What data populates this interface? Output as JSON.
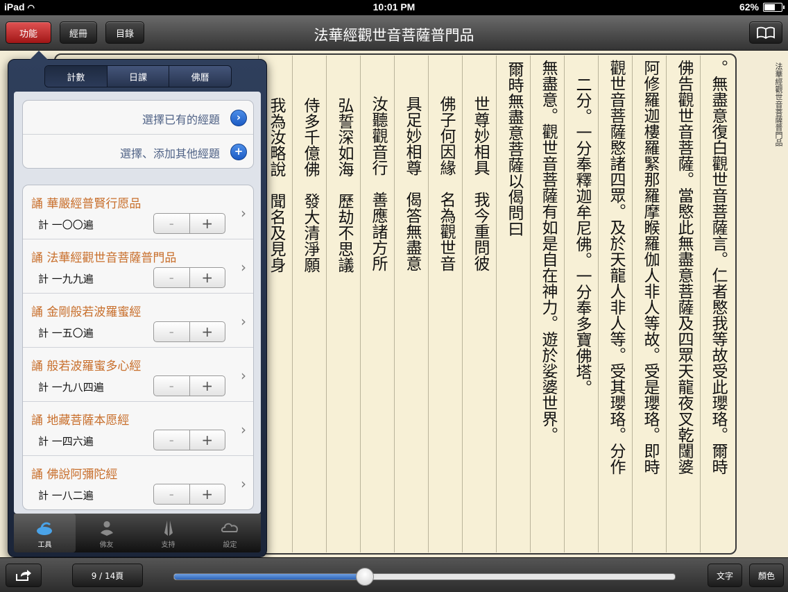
{
  "status_bar": {
    "device": "iPad",
    "time": "10:01 PM",
    "battery": "62%"
  },
  "nav": {
    "left_buttons": [
      "功能",
      "經冊",
      "目錄"
    ],
    "title": "法華經觀世音菩薩普門品"
  },
  "page": {
    "side_title": "法華經觀世音菩薩普門品",
    "columns": [
      "。無盡意復白觀世音菩薩言。仁者愍我等故受此瓔珞。爾時",
      "佛告觀世音菩薩。當愍此無盡意菩薩及四眾天龍夜叉乾闥婆",
      "阿修羅迦樓羅緊那羅摩睺羅伽人非人等故。受是瓔珞。即時",
      "觀世音菩薩愍諸四眾。及於天龍人非人等。受其瓔珞。分作",
      "二分。一分奉釋迦牟尼佛。一分奉多寶佛塔。",
      "無盡意。觀世音菩薩有如是自在神力。遊於娑婆世界。",
      "爾時無盡意菩薩以偈問曰",
      "世尊妙相具　我今重問彼",
      "佛子何因緣　名為觀世音",
      "具足妙相尊　偈答無盡意",
      "汝聽觀音行　善應諸方所",
      "弘誓深如海　歷劫不思議",
      "侍多千億佛　發大清淨願",
      "我為汝略說　聞名及見身"
    ]
  },
  "popover": {
    "segments": [
      "計數",
      "日課",
      "佛曆"
    ],
    "selected_segment": "計數",
    "actions": [
      {
        "label": "選擇已有的經題",
        "icon": "chevron-circle-icon"
      },
      {
        "label": "選擇、添加其他經題",
        "icon": "plus-circle-icon"
      }
    ],
    "counters": [
      {
        "title": "誦 華嚴經普賢行愿品",
        "count": "計 一〇〇遍"
      },
      {
        "title": "誦 法華經觀世音菩薩普門品",
        "count": "計 一九九遍"
      },
      {
        "title": "誦 金剛般若波羅蜜經",
        "count": "計 一五〇遍"
      },
      {
        "title": "誦 般若波羅蜜多心經",
        "count": "計 一九八四遍"
      },
      {
        "title": "誦 地藏菩薩本愿經",
        "count": "計 一四六遍"
      },
      {
        "title": "誦 佛說阿彌陀經",
        "count": "計 一八二遍"
      }
    ],
    "stepper": {
      "minus": "-",
      "plus": "+"
    },
    "tabs": [
      {
        "label": "工具",
        "selected": true
      },
      {
        "label": "佛友",
        "selected": false
      },
      {
        "label": "支持",
        "selected": false
      },
      {
        "label": "設定",
        "selected": false
      }
    ]
  },
  "bottom_bar": {
    "page_indicator": "9 / 14頁",
    "progress": 0.38,
    "text_button": "文字",
    "color_button": "顏色"
  }
}
